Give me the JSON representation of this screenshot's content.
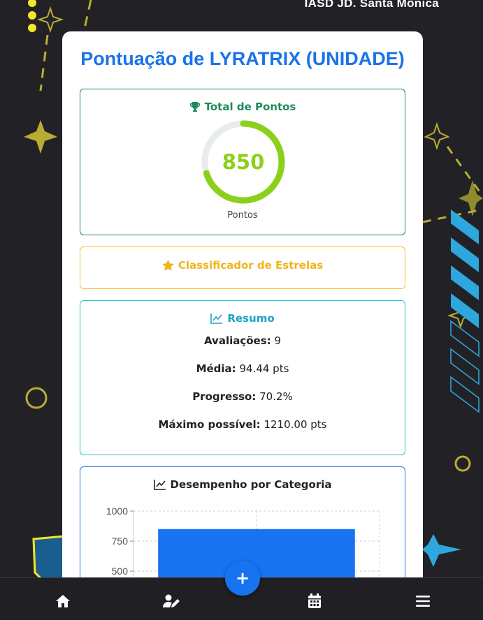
{
  "header": {
    "org_name": "IASD JD. Santa Mônica"
  },
  "page": {
    "title": "Pontuação de LYRATRIX (UNIDADE)"
  },
  "total": {
    "heading": "Total de Pontos",
    "points": "850",
    "points_label": "Pontos",
    "progress": 0.702,
    "ring_color": "#8bd11b"
  },
  "stars": {
    "heading": "Classificador de Estrelas"
  },
  "resumo": {
    "heading": "Resumo",
    "avaliacoes_label": "Avaliações:",
    "avaliacoes_value": "9",
    "media_label": "Média:",
    "media_value": "94.44 pts",
    "progresso_label": "Progresso:",
    "progresso_value": "70.2%",
    "maximo_label": "Máximo possível:",
    "maximo_value": "1210.00 pts"
  },
  "chart_data": {
    "type": "bar",
    "title": "Desempenho por Categoria",
    "categories": [
      ""
    ],
    "values": [
      850
    ],
    "ylim": [
      0,
      1000
    ],
    "yticks": [
      "1000",
      "750",
      "500"
    ],
    "bar_color": "#1873f0",
    "grid": true
  },
  "nav": {
    "items": [
      {
        "icon": "home-icon"
      },
      {
        "icon": "user-edit-icon"
      },
      {
        "icon": "calendar-icon"
      },
      {
        "icon": "menu-icon"
      }
    ],
    "fab_label": "+"
  },
  "colors": {
    "accent": "#1a73e8",
    "background": "#222226"
  }
}
